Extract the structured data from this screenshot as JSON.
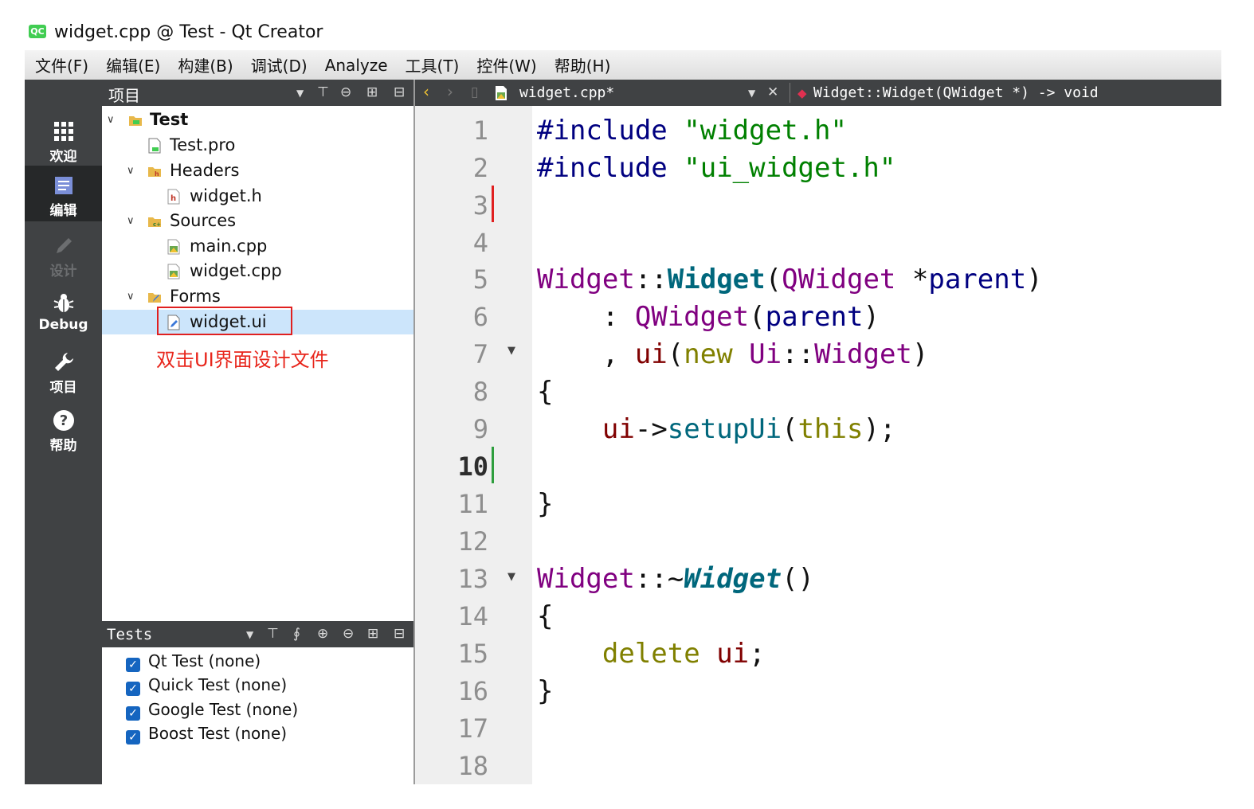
{
  "window": {
    "title": "widget.cpp @ Test - Qt Creator",
    "logo": "QC"
  },
  "menu": [
    "文件(F)",
    "编辑(E)",
    "构建(B)",
    "调试(D)",
    "Analyze",
    "工具(T)",
    "控件(W)",
    "帮助(H)"
  ],
  "modes": [
    {
      "label": "欢迎",
      "icon": "welcome-grid-icon"
    },
    {
      "label": "编辑",
      "icon": "edit-document-icon"
    },
    {
      "label": "设计",
      "icon": "design-pencil-icon"
    },
    {
      "label": "Debug",
      "icon": "debug-bug-icon"
    },
    {
      "label": "项目",
      "icon": "project-wrench-icon"
    },
    {
      "label": "帮助",
      "icon": "help-question-icon"
    }
  ],
  "project_pane": {
    "title": "项目",
    "tree": [
      {
        "label": "Test",
        "icon": "qt-project-folder-icon"
      },
      {
        "label": "Test.pro",
        "icon": "pro-file-icon"
      },
      {
        "label": "Headers",
        "icon": "headers-folder-icon"
      },
      {
        "label": "widget.h",
        "icon": "header-file-icon"
      },
      {
        "label": "Sources",
        "icon": "sources-folder-icon"
      },
      {
        "label": "main.cpp",
        "icon": "cpp-file-icon"
      },
      {
        "label": "widget.cpp",
        "icon": "cpp-file-icon"
      },
      {
        "label": "Forms",
        "icon": "forms-folder-icon"
      },
      {
        "label": "widget.ui",
        "icon": "ui-form-file-icon"
      }
    ],
    "annotation": "双击UI界面设计文件"
  },
  "tests_pane": {
    "title": "Tests",
    "items": [
      "Qt Test (none)",
      "Quick Test (none)",
      "Google Test (none)",
      "Boost Test (none)"
    ]
  },
  "editor": {
    "file": "widget.cpp*",
    "symbol": "Widget::Widget(QWidget *) -> void",
    "current_line": "10",
    "line_numbers": [
      "1",
      "2",
      "3",
      "4",
      "5",
      "6",
      "7",
      "8",
      "9",
      "10",
      "11",
      "12",
      "13",
      "14",
      "15",
      "16",
      "17",
      "18"
    ],
    "code": {
      "l1_directive": "#include",
      "l1_string": "\"widget.h\"",
      "l2_directive": "#include",
      "l2_string": "\"ui_widget.h\"",
      "l5_class": "Widget",
      "l5_scope": "::",
      "l5_ctor": "Widget",
      "l5_open": "(",
      "l5_type": "QWidget",
      "l5_ptr": " *",
      "l5_param": "parent",
      "l5_close": ")",
      "l6_colon": "    : ",
      "l6_base": "QWidget",
      "l6_open": "(",
      "l6_param": "parent",
      "l6_close": ")",
      "l7_comma": "    , ",
      "l7_member": "ui",
      "l7_open": "(",
      "l7_new": "new",
      "l7_ns": "Ui",
      "l7_scope": "::",
      "l7_class": "Widget",
      "l7_close": ")",
      "l8": "{",
      "l9_member": "ui",
      "l9_arrow": "->",
      "l9_call": "setupUi",
      "l9_open": "(",
      "l9_this": "this",
      "l9_close": ");",
      "l11": "}",
      "l13_class": "Widget",
      "l13_scope": "::~",
      "l13_dtor": "Widget",
      "l13_parens": "()",
      "l14": "{",
      "l15_delete": "delete",
      "l15_member": "ui",
      "l15_semi": ";",
      "l16": "}"
    }
  },
  "colors": {
    "sidebar": "#404244",
    "menubar": "#dedede",
    "selection": "#cce5fb",
    "annotation": "#e02020",
    "checkbox": "#1565c0"
  }
}
